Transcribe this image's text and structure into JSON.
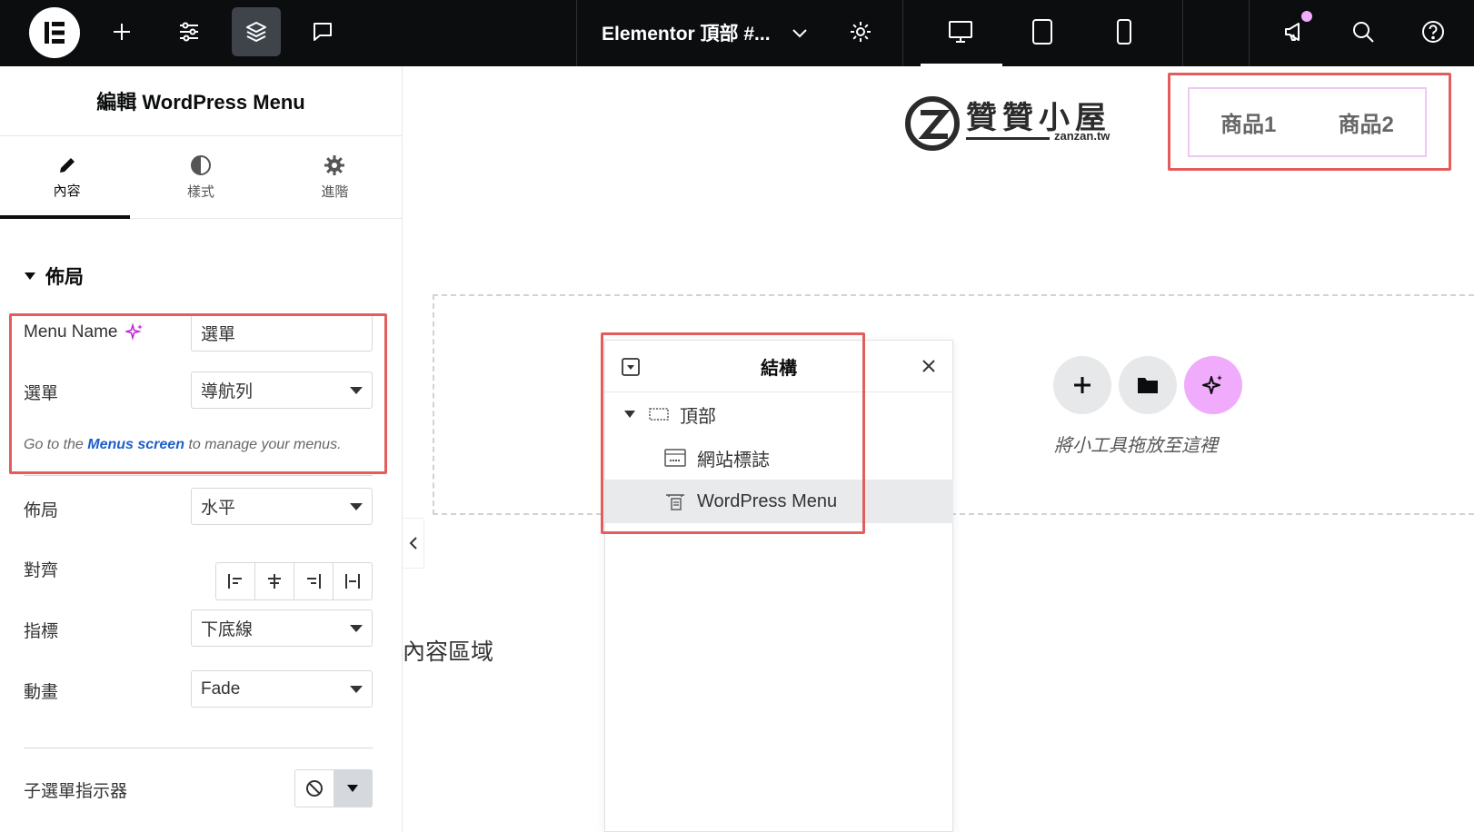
{
  "topbar": {
    "doc_title": "Elementor 頂部 #...",
    "icons": [
      "elementor-logo-icon",
      "plus-icon",
      "sliders-icon",
      "layers-icon",
      "chat-icon",
      "chevron-down-icon",
      "gear-icon",
      "desktop-icon",
      "tablet-icon",
      "mobile-icon",
      "megaphone-icon",
      "search-icon",
      "help-icon"
    ],
    "notification_color": "#f0abfc"
  },
  "panel": {
    "title": "編輯 WordPress Menu",
    "tabs": [
      {
        "label": "內容",
        "icon": "pencil-icon"
      },
      {
        "label": "樣式",
        "icon": "contrast-icon"
      },
      {
        "label": "進階",
        "icon": "gear-icon"
      }
    ],
    "section": "佈局",
    "menu_name_label": "Menu Name",
    "menu_name_value": "選單",
    "menu_label": "選單",
    "menu_value": "導航列",
    "help_prefix": "Go to the ",
    "help_link": "Menus screen",
    "help_suffix": " to manage your menus.",
    "layout_label": "佈局",
    "layout_value": "水平",
    "align_label": "對齊",
    "pointer_label": "指標",
    "pointer_value": "下底線",
    "animation_label": "動畫",
    "animation_value": "Fade",
    "submenu_indicator_label": "子選單指示器"
  },
  "canvas": {
    "logo_text": "贊贊小屋",
    "logo_sub": "zanzan.tw",
    "menu_items": [
      "商品1",
      "商品2"
    ],
    "drop_text": "將小工具拖放至這裡",
    "content_area": "內容區域",
    "ai_button_color": "#f0abfc"
  },
  "structure": {
    "title": "結構",
    "items": [
      {
        "label": "頂部",
        "icon": "container-icon"
      },
      {
        "label": "網站標誌",
        "icon": "site-logo-icon"
      },
      {
        "label": "WordPress Menu",
        "icon": "menu-widget-icon"
      }
    ]
  },
  "colors": {
    "highlight": "#e35d5d",
    "link": "#1f5fcc"
  }
}
